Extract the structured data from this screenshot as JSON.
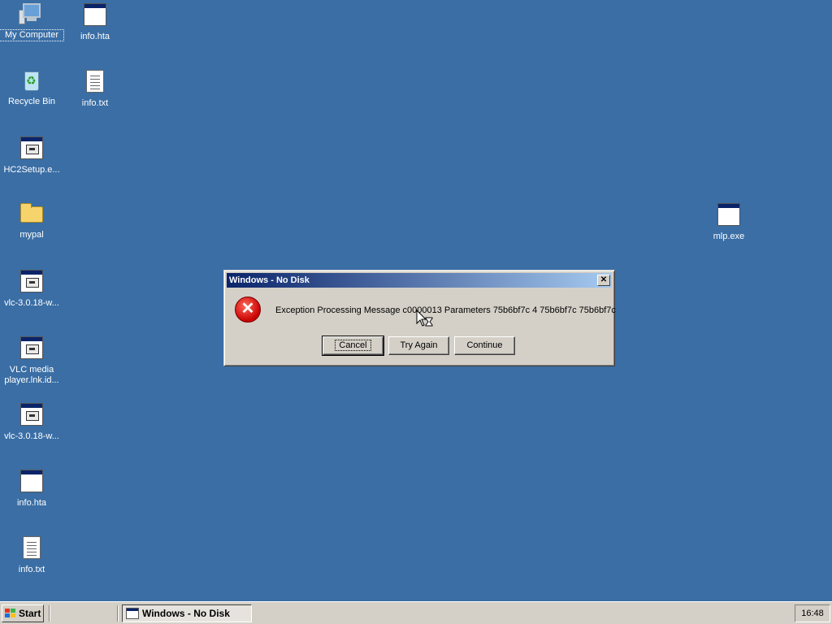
{
  "desktop": {
    "icons": [
      {
        "label": "My Computer",
        "kind": "computer-icon"
      },
      {
        "label": "Recycle Bin",
        "kind": "recycle-bin-icon"
      },
      {
        "label": "HC2Setup.e...",
        "kind": "application-icon"
      },
      {
        "label": "mypal",
        "kind": "folder-icon"
      },
      {
        "label": "vlc-3.0.18-w...",
        "kind": "application-icon"
      },
      {
        "label": "VLC media player.lnk.id...",
        "kind": "application-icon"
      },
      {
        "label": "vlc-3.0.18-w...",
        "kind": "application-icon"
      },
      {
        "label": "info.hta",
        "kind": "application-icon"
      },
      {
        "label": "info.txt",
        "kind": "text-file-icon"
      },
      {
        "label": "info.hta",
        "kind": "application-icon"
      },
      {
        "label": "info.txt",
        "kind": "text-file-icon"
      },
      {
        "label": "mlp.exe",
        "kind": "application-icon"
      }
    ]
  },
  "dialog": {
    "title": "Windows - No Disk",
    "close_glyph": "✕",
    "message": "Exception Processing Message c0000013 Parameters 75b6bf7c 4 75b6bf7c 75b6bf7c",
    "icon": "error-icon",
    "buttons": {
      "cancel": "Cancel",
      "try_again": "Try Again",
      "continue": "Continue"
    }
  },
  "taskbar": {
    "start_label": "Start",
    "task_label": "Windows - No Disk",
    "clock": "16:48"
  },
  "colors": {
    "desktop": "#3a6ea5",
    "titlebar_start": "#0a246a",
    "titlebar_end": "#a6caf0",
    "face": "#d4d0c8"
  }
}
